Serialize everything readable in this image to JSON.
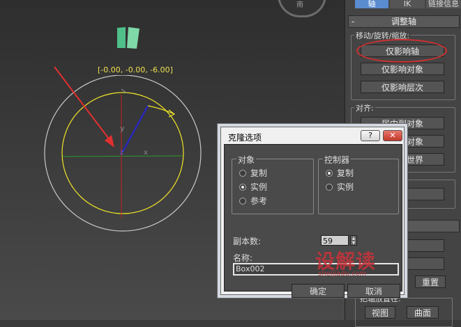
{
  "viewport": {
    "coordinate_readout": "[-0.00, -0.00, -6.00]",
    "viewcube_label": "南",
    "axis_x": "x",
    "axis_y": "y",
    "axis_z": "z"
  },
  "panel": {
    "tabs": [
      "轴",
      "IK",
      "链接信息"
    ],
    "rollout_title": "调整轴",
    "rollout_collapse": "-",
    "move_group": {
      "title": "移动/旋转/缩放:",
      "buttons": [
        "仅影响轴",
        "仅影响对象",
        "仅影响层次"
      ]
    },
    "align_group": {
      "title": "对齐:",
      "buttons": [
        "居中到对象",
        "对齐到对象",
        "对齐到世界"
      ]
    },
    "partial_buttons": [
      "轴",
      "轴",
      "轴",
      "重置"
    ],
    "place_pivot_group": {
      "title": "把轴放置在:",
      "buttons": [
        "视图",
        "曲面"
      ]
    },
    "highlight_color": "#d03030"
  },
  "dialog": {
    "title": "克隆选项",
    "help_label": "?",
    "close_label": "✕",
    "object_group": {
      "title": "对象",
      "options": [
        {
          "label": "复制",
          "selected": false
        },
        {
          "label": "实例",
          "selected": true
        },
        {
          "label": "参考",
          "selected": false
        }
      ]
    },
    "controller_group": {
      "title": "控制器",
      "options": [
        {
          "label": "复制",
          "selected": true
        },
        {
          "label": "实例",
          "selected": false
        }
      ]
    },
    "copies_label": "副本数:",
    "copies_value": "59",
    "name_label": "名称:",
    "name_value": "Box002",
    "ok_label": "确定",
    "cancel_label": "取消"
  },
  "watermark": {
    "text": "设解读",
    "url": "sheijiadu.com"
  }
}
